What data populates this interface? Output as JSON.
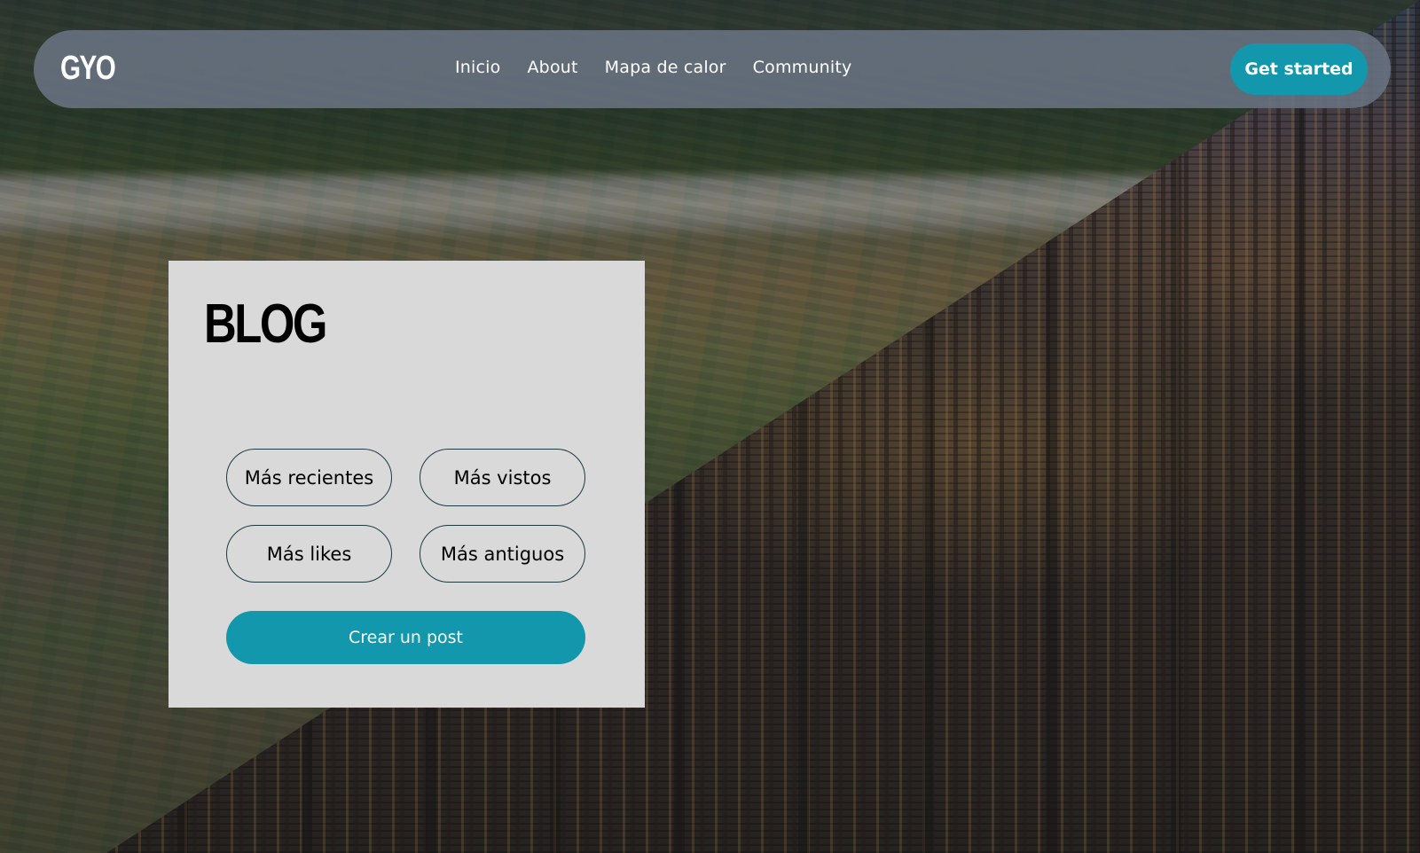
{
  "navbar": {
    "logo": "GYO",
    "links": [
      {
        "label": "Inicio"
      },
      {
        "label": "About"
      },
      {
        "label": "Mapa de calor"
      },
      {
        "label": "Community"
      }
    ],
    "cta_label": "Get started"
  },
  "blog": {
    "title": "BLOG",
    "filters": [
      {
        "label": "Más recientes"
      },
      {
        "label": "Más vistos"
      },
      {
        "label": "Más likes"
      },
      {
        "label": "Más antiguos"
      }
    ],
    "create_label": "Crear un post"
  },
  "colors": {
    "accent": "#1297ad",
    "card_background": "#d9d9d9",
    "navbar_background": "#69737f",
    "filter_border": "#1d3b3f"
  }
}
